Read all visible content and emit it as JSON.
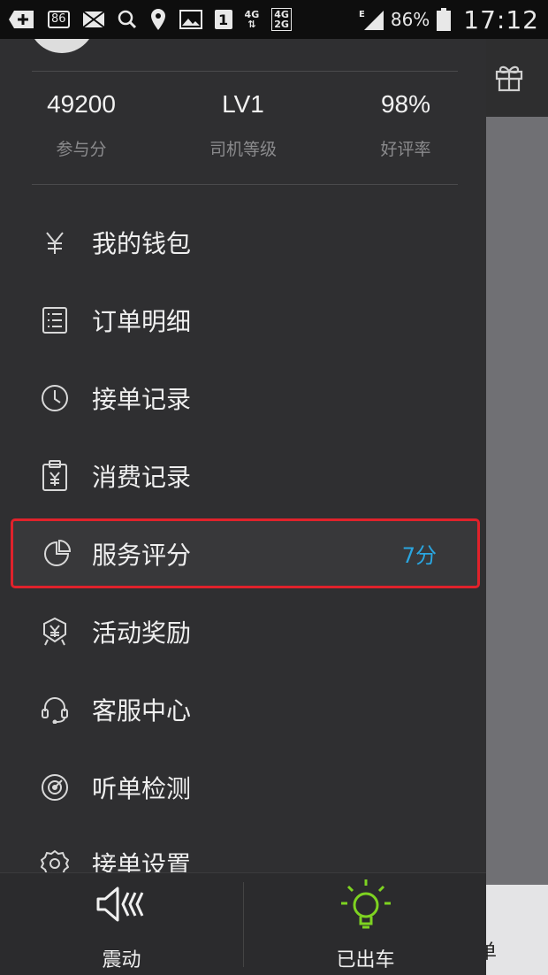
{
  "status_bar": {
    "badge": "86",
    "sim": "1",
    "net_top": "4G",
    "net_box_top": "4G",
    "net_box_bottom": "2G",
    "net_e": "E",
    "battery": "86%",
    "time": "17:12"
  },
  "stats": [
    {
      "value": "49200",
      "label": "参与分"
    },
    {
      "value": "LV1",
      "label": "司机等级"
    },
    {
      "value": "98%",
      "label": "好评率"
    }
  ],
  "menu": [
    {
      "label": "我的钱包",
      "icon": "yuan-icon"
    },
    {
      "label": "订单明细",
      "icon": "list-icon"
    },
    {
      "label": "接单记录",
      "icon": "clock-icon"
    },
    {
      "label": "消费记录",
      "icon": "receipt-icon"
    },
    {
      "label": "服务评分",
      "icon": "pie-chart-icon",
      "value": "7分",
      "highlighted": true
    },
    {
      "label": "活动奖励",
      "icon": "reward-badge-icon"
    },
    {
      "label": "客服中心",
      "icon": "headset-icon"
    },
    {
      "label": "听单检测",
      "icon": "radar-icon"
    },
    {
      "label": "接单设置",
      "icon": "gear-icon"
    }
  ],
  "bottom_bar": {
    "vibrate_label": "震动",
    "status_label": "已出车"
  },
  "background_partial_text": "单",
  "colors": {
    "highlight_border": "#e0222b",
    "score_value": "#2aa6e0",
    "bulb_green": "#7ed321"
  }
}
